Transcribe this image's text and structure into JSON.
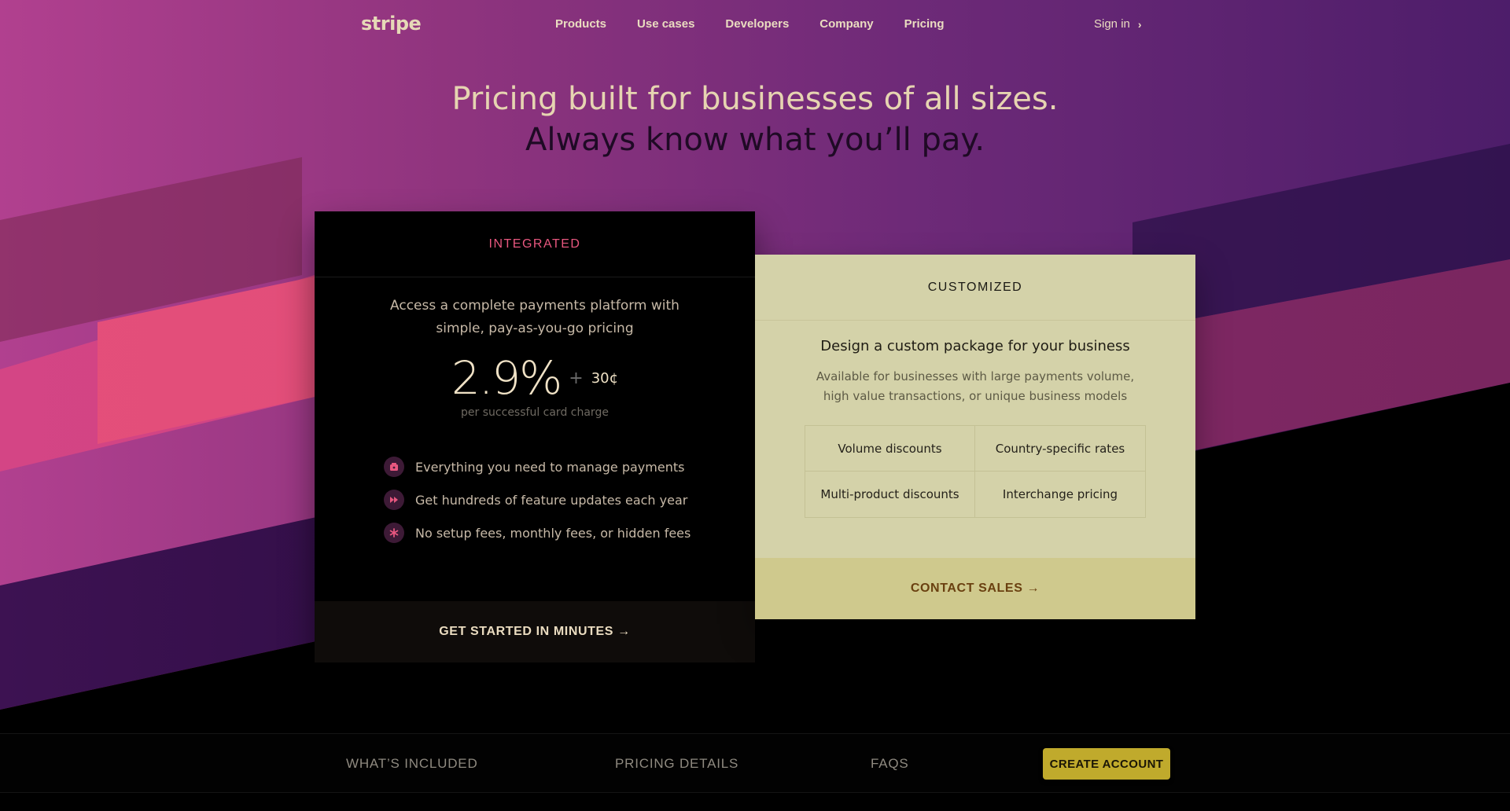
{
  "nav": {
    "logo": "stripe",
    "links": [
      "Products",
      "Use cases",
      "Developers",
      "Company",
      "Pricing"
    ],
    "signin": "Sign in"
  },
  "hero": {
    "line1": "Pricing built for businesses of all sizes.",
    "line2": "Always know what you’ll pay."
  },
  "integrated": {
    "label": "INTEGRATED",
    "desc_line1": "Access a complete payments platform with",
    "desc_line2": "simple, pay-as-you-go pricing",
    "price": "2.9%",
    "plus": "+",
    "fixed_fee": "30¢",
    "price_note": "per successful card charge",
    "features": [
      {
        "text": "Everything you need to manage payments",
        "icon": "wallet-icon"
      },
      {
        "text": "Get hundreds of feature updates each year",
        "icon": "fast-forward-icon"
      },
      {
        "text": "No setup fees, monthly fees, or hidden fees",
        "icon": "asterisk-icon"
      }
    ],
    "cta": "GET STARTED IN MINUTES →"
  },
  "customized": {
    "label": "CUSTOMIZED",
    "title": "Design a custom package for your business",
    "desc_line1": "Available for businesses with large payments volume,",
    "desc_line2": "high value transactions, or unique business models",
    "options": [
      "Volume discounts",
      "Country-specific rates",
      "Multi-product discounts",
      "Interchange pricing"
    ],
    "cta": "CONTACT SALES →"
  },
  "bottom_nav": {
    "tabs": [
      "WHAT’S INCLUDED",
      "PRICING DETAILS",
      "FAQS"
    ],
    "create_account": "CREATE ACCOUNT"
  },
  "colors": {
    "accent_pink": "#e8577f",
    "button_gold": "#c0aa2c",
    "card_cream": "#d4d2a9"
  }
}
